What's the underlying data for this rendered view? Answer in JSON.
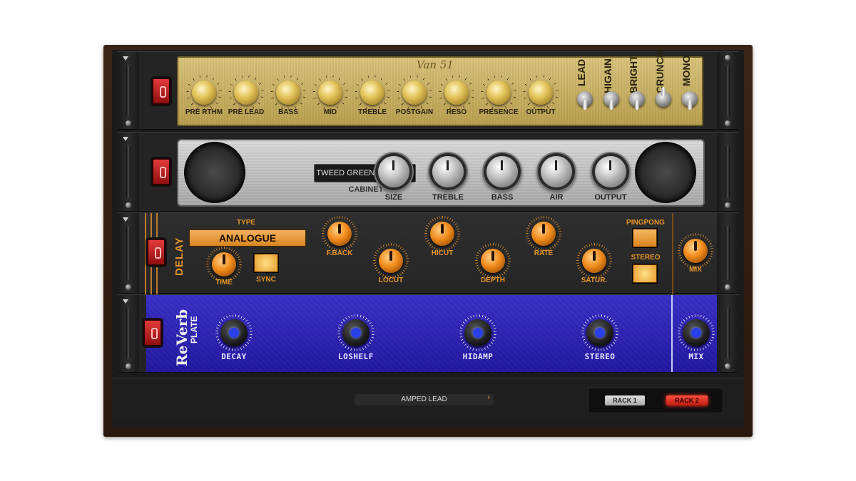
{
  "amp": {
    "logo": "Van 51",
    "knobs": [
      "PRE RTHM",
      "PRE LEAD",
      "BASS",
      "MID",
      "TREBLE",
      "POSTGAIN",
      "RESO",
      "PRESENCE",
      "OUTPUT"
    ],
    "switches": [
      "LEAD",
      "HIGAIN",
      "BRIGHT",
      "CRUNCH",
      "MONO"
    ]
  },
  "cabinet": {
    "model": "TWEED GREEN (ON AXIS)",
    "label": "CABINET",
    "knobs": [
      "SIZE",
      "TREBLE",
      "BASS",
      "AIR",
      "OUTPUT"
    ]
  },
  "delay": {
    "title": "DELAY",
    "type_label": "TYPE",
    "type_value": "ANALOGUE",
    "time": "TIME",
    "sync": "SYNC",
    "knobs": [
      "F.BACK",
      "LOCUT",
      "HICUT",
      "DEPTH",
      "RATE",
      "SATUR."
    ],
    "pingpong": "PINGPONG",
    "stereo": "STEREO",
    "mix": "MIX"
  },
  "reverb": {
    "title": "ReVerb",
    "subtitle": "PLATE",
    "knobs": [
      "DECAY",
      "LOSHELF",
      "HIDAMP",
      "STEREO"
    ],
    "mix": "MIX"
  },
  "footer": {
    "preset": "AMPED LEAD",
    "rack1": "RACK 1",
    "rack2": "RACK 2"
  },
  "colors": {
    "reverb_panel": "#2a20b4",
    "delay_accent": "#e6952a",
    "rack2_active": "#e02a2a",
    "amp_panel": "#c9b263"
  }
}
